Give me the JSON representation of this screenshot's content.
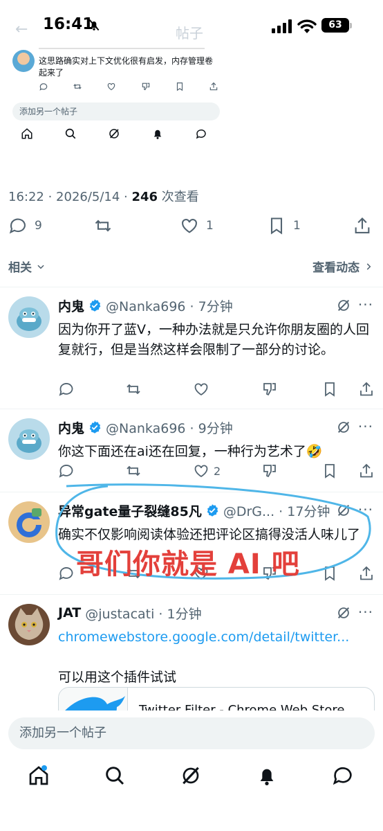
{
  "status": {
    "time": "16:41",
    "battery": "63",
    "back_ghost": "←",
    "title_ghost": "帖子"
  },
  "embed": {
    "text": "这思路确实对上下文优化很有启发，内存管理卷起来了",
    "reply_placeholder": "添加另一个帖子"
  },
  "tweet": {
    "time": "16:22 · 2026/5/14 · ",
    "views": "246",
    "views_label": " 次查看",
    "replies": "9",
    "likes": "1",
    "bookmarks": "1"
  },
  "related": {
    "label": "相关",
    "view_activity": "查看动态"
  },
  "replies": [
    {
      "name": "内鬼",
      "handle": "@Nanka696 · 7分钟",
      "text": "因为你开了蓝V，一种办法就是只允许你朋友圈的人回复就行，但是当然这样会限制了一部分的讨论。",
      "likes": ""
    },
    {
      "name": "内鬼",
      "handle": "@Nanka696 · 9分钟",
      "text": "你这下面还在ai还在回复，一种行为艺术了🤣",
      "likes": "2"
    },
    {
      "name": "异常gate量子裂缝85凡",
      "handle": "@DrG... · 17分钟",
      "text": "确实不仅影响阅读体验还把评论区搞得没活人味儿了",
      "likes": ""
    },
    {
      "name": "JAT",
      "handle": "@justacati · 1分钟",
      "link": "chromewebstore.google.com/detail/twitter...",
      "text": "可以用这个插件试试",
      "card_title": "Twitter Filter - Chrome Web Store"
    }
  ],
  "annotation": {
    "text": "哥们你就是 AI 吧"
  },
  "compose": {
    "placeholder": "添加另一个帖子"
  },
  "colors": {
    "accent": "#1d9bf0",
    "annotation": "#e3403b",
    "annotation_ring": "#4fb6e8"
  }
}
